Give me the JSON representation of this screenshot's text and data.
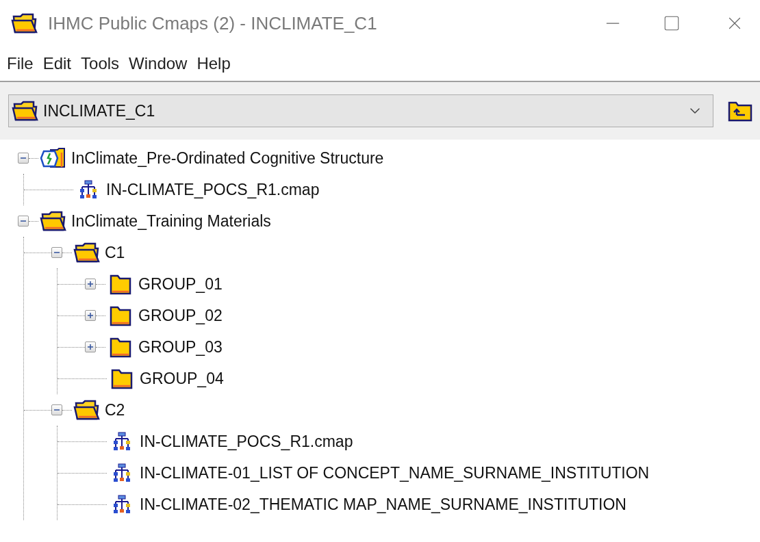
{
  "window": {
    "title": "IHMC Public Cmaps (2) - INCLIMATE_C1"
  },
  "menu": [
    "File",
    "Edit",
    "Tools",
    "Window",
    "Help"
  ],
  "location": {
    "value": "INCLIMATE_C1"
  },
  "tree": [
    {
      "kind": "cmap-folder",
      "label": "InClimate_Pre-Ordinated Cognitive Structure",
      "expanded": true,
      "children": [
        {
          "kind": "cmap",
          "label": "IN-CLIMATE_POCS_R1.cmap"
        }
      ]
    },
    {
      "kind": "folder",
      "label": "InClimate_Training Materials",
      "expanded": true,
      "children": [
        {
          "kind": "folder",
          "label": "C1",
          "expanded": true,
          "children": [
            {
              "kind": "folder",
              "label": "GROUP_01",
              "expanded": false
            },
            {
              "kind": "folder",
              "label": "GROUP_02",
              "expanded": false
            },
            {
              "kind": "folder",
              "label": "GROUP_03",
              "expanded": false
            },
            {
              "kind": "folder",
              "label": "GROUP_04"
            }
          ]
        },
        {
          "kind": "folder",
          "label": "C2",
          "expanded": true,
          "children": [
            {
              "kind": "cmap",
              "label": "IN-CLIMATE_POCS_R1.cmap"
            },
            {
              "kind": "cmap",
              "label": "IN-CLIMATE-01_LIST OF CONCEPT_NAME_SURNAME_INSTITUTION"
            },
            {
              "kind": "cmap",
              "label": "IN-CLIMATE-02_THEMATIC MAP_NAME_SURNAME_INSTITUTION"
            }
          ]
        }
      ]
    }
  ]
}
